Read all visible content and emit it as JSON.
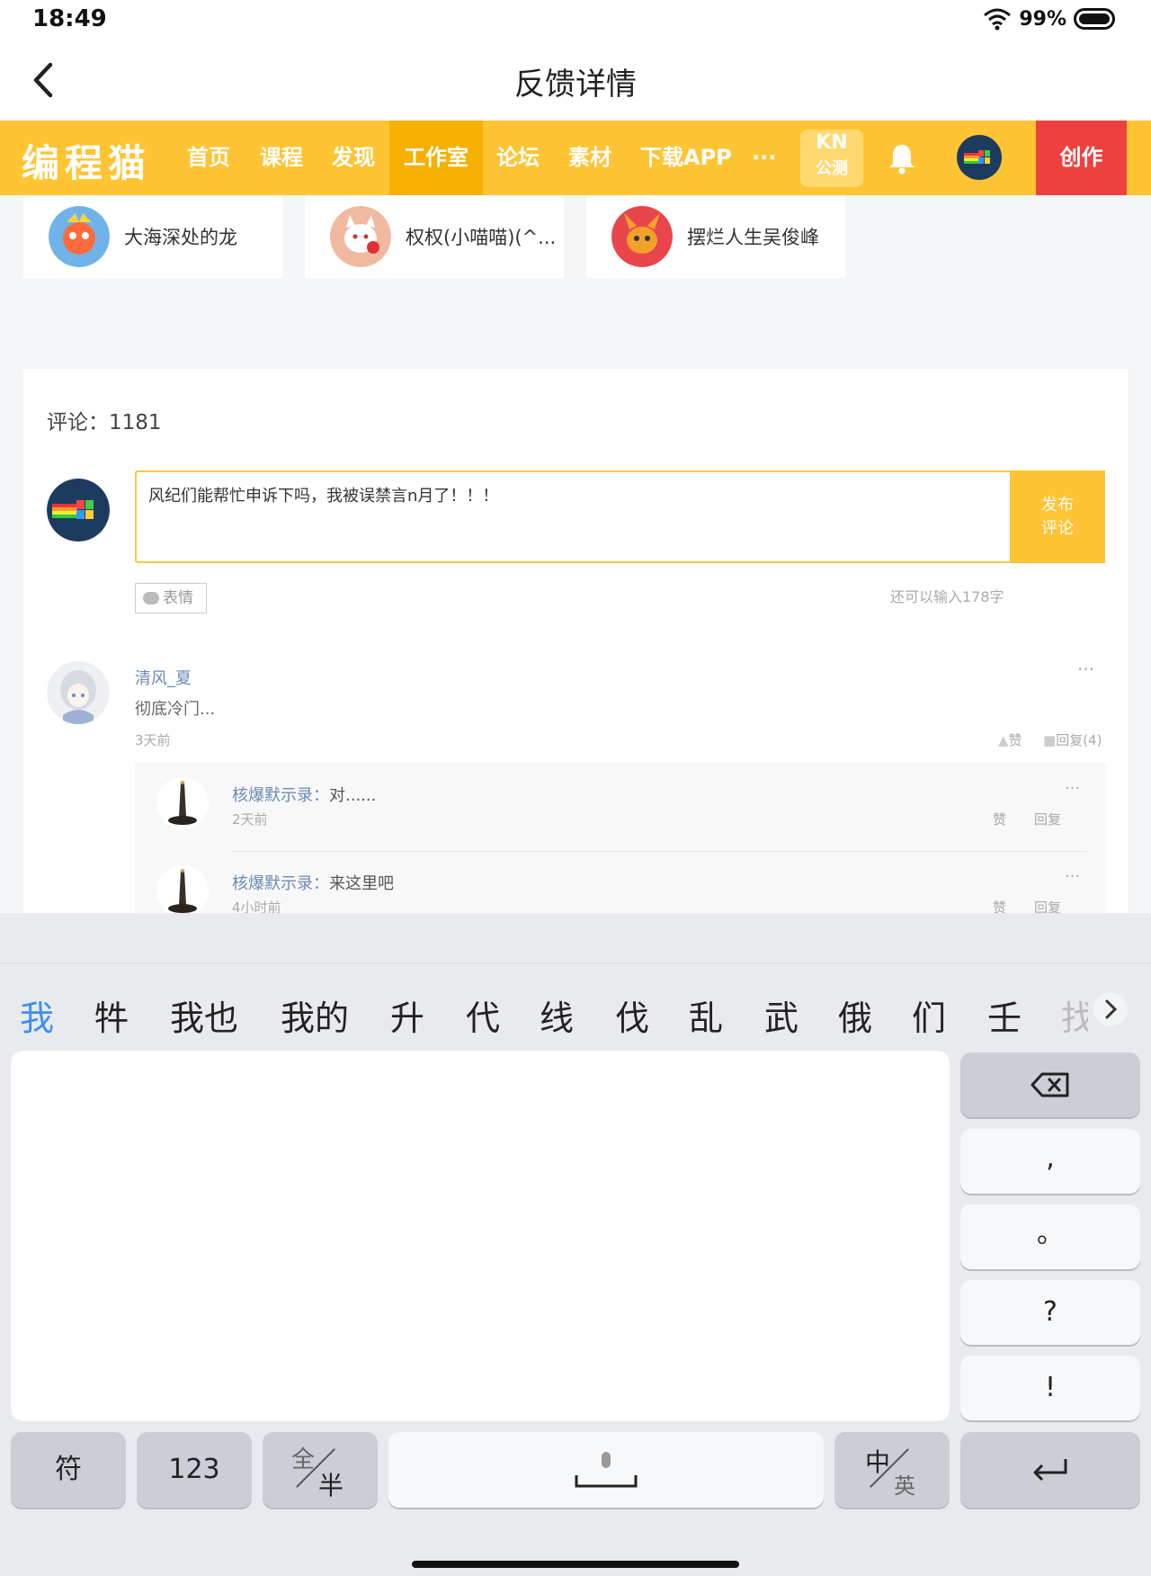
{
  "status_bar": {
    "time": "18:49",
    "battery_percent": "99%"
  },
  "title_bar": {
    "title": "反馈详情"
  },
  "nav": {
    "logo": "编程猫",
    "items": [
      "首页",
      "课程",
      "发现",
      "工作室",
      "论坛",
      "素材",
      "下载APP",
      "···"
    ],
    "active_item": "工作室",
    "kn_badge_top": "KN",
    "kn_badge_bottom": "公测",
    "create_label": "创作",
    "accent_color": "#fec433",
    "create_color": "#ef4040"
  },
  "user_cards": [
    {
      "name": "大海深处的龙"
    },
    {
      "name": "权权(小喵喵)(^..."
    },
    {
      "name": "摆烂人生吴俊峰"
    }
  ],
  "comments_section": {
    "count_label": "评论：1181",
    "input_value": "风纪们能帮忙申诉下吗，我被误禁言n月了！！！",
    "publish_label_1": "发布",
    "publish_label_2": "评论",
    "emoji_label": "表情",
    "remaining_label": "还可以输入178字",
    "comment": {
      "author": "清风_夏",
      "text": "彻底冷门...",
      "time": "3天前",
      "like_label": "赞",
      "reply_label": "回复(4)",
      "more": "···"
    },
    "replies": [
      {
        "author": "核爆默示录：",
        "text": "对......",
        "time": "2天前",
        "like_label": "赞",
        "reply_label": "回复",
        "more": "···"
      },
      {
        "author": "核爆默示录：",
        "text": "来这里吧",
        "time": "4小时前",
        "like_label": "赞",
        "reply_label": "回复",
        "more": "···"
      }
    ]
  },
  "keyboard": {
    "candidates": [
      "我",
      "牪",
      "我也",
      "我的",
      "升",
      "代",
      "线",
      "伐",
      "乱",
      "武",
      "俄",
      "们",
      "壬",
      "找"
    ],
    "selected_candidate": "我",
    "side_keys": [
      ",",
      "。",
      "?",
      "!"
    ],
    "bottom_keys": {
      "symbols": "符",
      "numbers": "123",
      "full_top": "全",
      "full_bottom": "半",
      "lang_top": "中",
      "lang_bottom": "英"
    }
  }
}
